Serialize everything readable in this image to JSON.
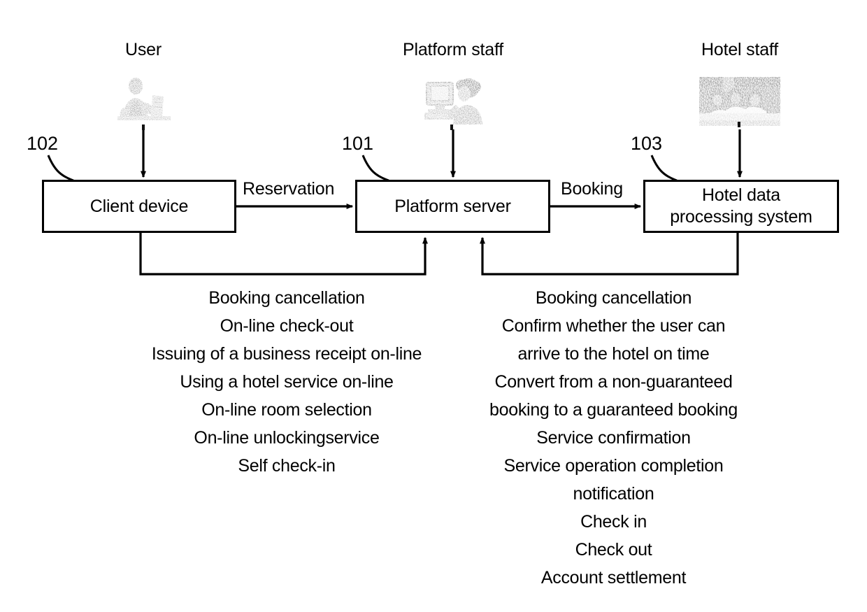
{
  "figure": {
    "actors": [
      {
        "id": "user",
        "label": "User",
        "icon": "person-at-desk-icon"
      },
      {
        "id": "platform-staff",
        "label": "Platform staff",
        "icon": "person-at-computer-icon"
      },
      {
        "id": "hotel-staff",
        "label": "Hotel staff",
        "icon": "hotel-staff-photo-icon"
      }
    ],
    "nodes": [
      {
        "id": "client-device",
        "ref": "102",
        "line1": "Client device",
        "line2": ""
      },
      {
        "id": "platform-server",
        "ref": "101",
        "line1": "Platform server",
        "line2": ""
      },
      {
        "id": "hotel-system",
        "ref": "103",
        "line1": "Hotel data",
        "line2": "processing system"
      }
    ],
    "edges": [
      {
        "id": "reservation",
        "label": "Reservation",
        "from": "client-device",
        "to": "platform-server"
      },
      {
        "id": "booking",
        "label": "Booking",
        "from": "platform-server",
        "to": "hotel-system"
      }
    ],
    "feedback_left": {
      "from": "client-device",
      "to": "platform-server",
      "messages": [
        "Booking cancellation",
        "On-line check-out",
        "Issuing of a business receipt on-line",
        "Using a hotel service on-line",
        "On-line room selection",
        "On-line unlockingservice",
        "Self check-in"
      ]
    },
    "feedback_right": {
      "from": "hotel-system",
      "to": "platform-server",
      "messages": [
        "Booking cancellation",
        "Confirm whether the user can",
        "arrive to the hotel on time",
        "Convert from a non-guaranteed",
        "booking to a guaranteed booking",
        "Service confirmation",
        "Service operation completion",
        "notification",
        "Check in",
        "Check out",
        "Account settlement"
      ]
    },
    "colors": {
      "ink": "#000000",
      "paper": "#ffffff"
    }
  }
}
